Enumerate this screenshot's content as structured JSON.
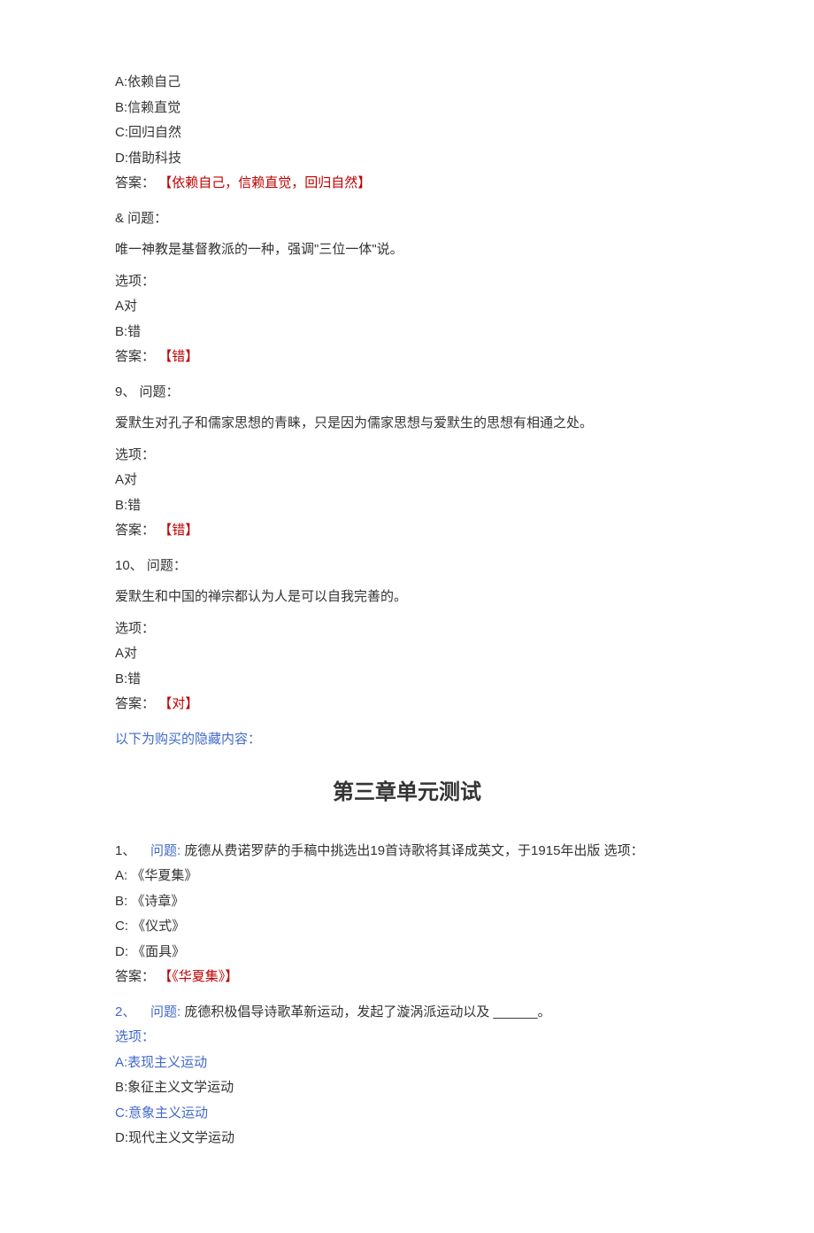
{
  "q7": {
    "optA": "A:依赖自己",
    "optB": "B:信赖直觉",
    "optC": "C:回归自然",
    "optD": "D:借助科技",
    "answer_label": "答案：",
    "answer_value": "【依赖自己，信赖直觉，回归自然】"
  },
  "q8": {
    "num": "&  问题：",
    "stem": "唯一神教是基督教派的一种，强调\"三位一体\"说。",
    "options_label": "选项：",
    "optA": "A对",
    "optB": "B:错",
    "answer_label": "答案：",
    "answer_value": "【错】"
  },
  "q9": {
    "num": "9、   问题：",
    "stem": "爱默生对孔子和儒家思想的青睐，只是因为儒家思想与爱默生的思想有相通之处。",
    "options_label": "选项：",
    "optA": "A对",
    "optB": "B:错",
    "answer_label": "答案：",
    "answer_value": "【错】"
  },
  "q10": {
    "num": "10、 问题：",
    "stem": "爱默生和中国的禅宗都认为人是可以自我完善的。",
    "options_label": "选项：",
    "optA": "A对",
    "optB": "B:错",
    "answer_label": "答案：",
    "answer_value": "【对】"
  },
  "hidden_note": "以下为购买的隐藏内容：",
  "chapter_title": "第三章单元测试",
  "c3q1": {
    "prefix": "1、",
    "num_label": "问题:",
    "stem_rest": "庞德从费诺罗萨的手稿中挑选出19首诗歌将其译成英文，于1915年出版  选项：",
    "optA": "A: 《华夏集》",
    "optB": "B: 《诗章》",
    "optC": "C: 《仪式》",
    "optD": "D: 《面具》",
    "answer_label": "答案：",
    "answer_value": "【《华夏集》】"
  },
  "c3q2": {
    "prefix": "2、",
    "num_label": "问题:",
    "stem_rest": "庞德积极倡导诗歌革新运动，发起了漩涡派运动以及 ______。",
    "options_label": "选项：",
    "optA": "A:表现主义运动",
    "optB": "B:象征主义文学运动",
    "optC": "C:意象主义运动",
    "optD": "D:现代主义文学运动"
  }
}
